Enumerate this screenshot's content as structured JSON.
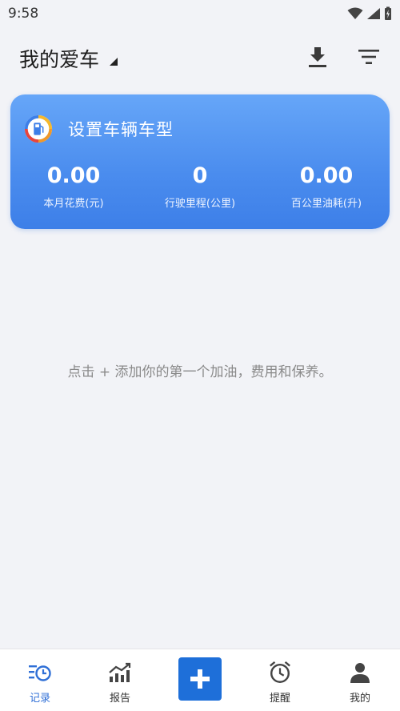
{
  "status_bar": {
    "time": "9:58"
  },
  "header": {
    "title": "我的爱车"
  },
  "card": {
    "title": "设置车辆车型",
    "stats": [
      {
        "value": "0.00",
        "label": "本月花费(元)"
      },
      {
        "value": "0",
        "label": "行驶里程(公里)"
      },
      {
        "value": "0.00",
        "label": "百公里油耗(升)"
      }
    ]
  },
  "empty_hint": "点击 + 添加你的第一个加油，费用和保养。",
  "nav": {
    "items": [
      {
        "label": "记录",
        "icon": "records-icon",
        "active": true
      },
      {
        "label": "报告",
        "icon": "report-chart-icon"
      },
      {
        "label": "",
        "icon": "add-icon"
      },
      {
        "label": "提醒",
        "icon": "alarm-clock-icon"
      },
      {
        "label": "我的",
        "icon": "person-icon"
      }
    ]
  },
  "colors": {
    "accent": "#1e6fd9",
    "card_gradient_top": "#66a6f8",
    "card_gradient_bottom": "#3d7fe8",
    "active_nav": "#2f6fd6",
    "background": "#f2f3f7"
  }
}
